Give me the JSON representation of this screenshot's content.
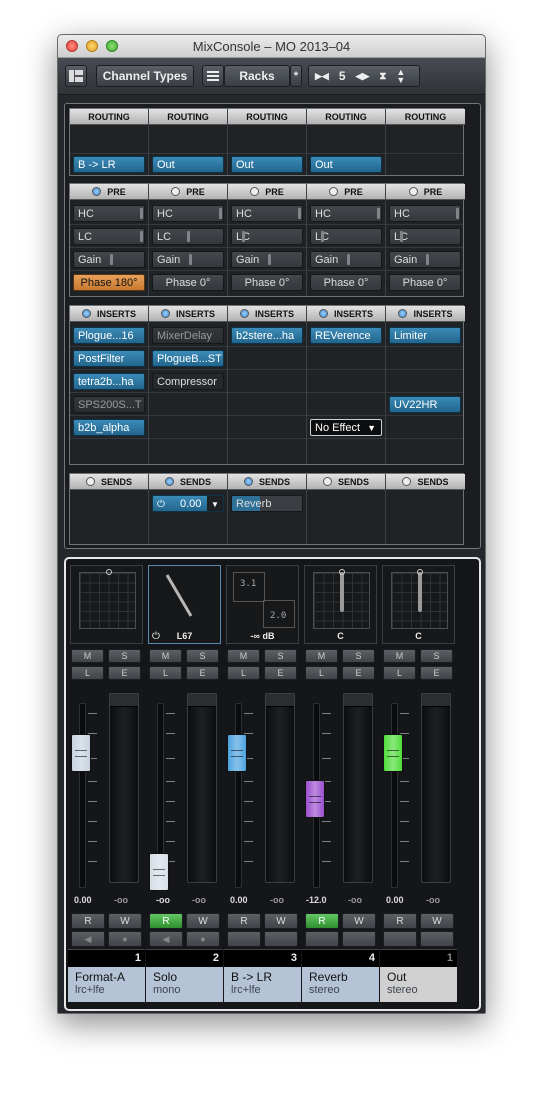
{
  "window": {
    "title": "MixConsole – MO 2013–04"
  },
  "toolbar": {
    "channel_types_label": "Channel Types",
    "racks_label": "Racks",
    "star_label": "*",
    "visible_channels": "5"
  },
  "sections": {
    "routing_label": "ROUTING",
    "pre_label": "PRE",
    "inserts_label": "INSERTS",
    "sends_label": "SENDS"
  },
  "routing": [
    "B -> LR",
    "Out",
    "Out",
    "Out",
    ""
  ],
  "pre": {
    "hc_label": "HC",
    "lc_label": "LC",
    "gain_label": "Gain",
    "phase": [
      "Phase 180°",
      "Phase 0°",
      "Phase 0°",
      "Phase 0°",
      "Phase 0°"
    ]
  },
  "inserts": {
    "ch1": [
      "Plogue...16",
      "PostFilter",
      "tetra2b...ha",
      "SPS200S...T",
      "b2b_alpha"
    ],
    "ch2": [
      "MixerDelay",
      "PlogueB...ST",
      "Compressor"
    ],
    "ch3": [
      "b2stere...ha"
    ],
    "ch4": [
      "REVerence",
      "No Effect"
    ],
    "ch5": [
      "Limiter",
      "UV22HR"
    ]
  },
  "sends": {
    "ch2_level": "0.00",
    "ch3_dest": "Reverb"
  },
  "panners": {
    "ch2_label": "L67",
    "ch3_label": "-∞ dB",
    "ch3_surround_top": "3.1",
    "ch3_surround_bottom": "2.0",
    "ch4_label": "C",
    "ch5_label": "C"
  },
  "buttons": {
    "m": "M",
    "s": "S",
    "l": "L",
    "e": "E",
    "r": "R",
    "w": "W"
  },
  "channels": [
    {
      "number": "1",
      "name": "Format-A",
      "type": "lrc+lfe",
      "volume": "0.00",
      "peak": "-oo",
      "fader_color": "#c8d3df",
      "fader_level": 0.78,
      "read_on": false
    },
    {
      "number": "2",
      "name": "Solo",
      "type": "mono",
      "volume": "-oo",
      "peak": "-oo",
      "fader_color": "#d5dde6",
      "fader_level": 0.0,
      "read_on": true
    },
    {
      "number": "3",
      "name": "B -> LR",
      "type": "lrc+lfe",
      "volume": "0.00",
      "peak": "-oo",
      "fader_color": "#4ca3e0",
      "fader_level": 0.78,
      "read_on": false
    },
    {
      "number": "4",
      "name": "Reverb",
      "type": "stereo",
      "volume": "-12.0",
      "peak": "-oo",
      "fader_color": "#9b4fcf",
      "fader_level": 0.48,
      "read_on": true
    },
    {
      "number": "1",
      "name": "Out",
      "type": "stereo",
      "volume": "0.00",
      "peak": "-oo",
      "fader_color": "#4fdc3a",
      "fader_level": 0.78,
      "read_on": false
    }
  ]
}
